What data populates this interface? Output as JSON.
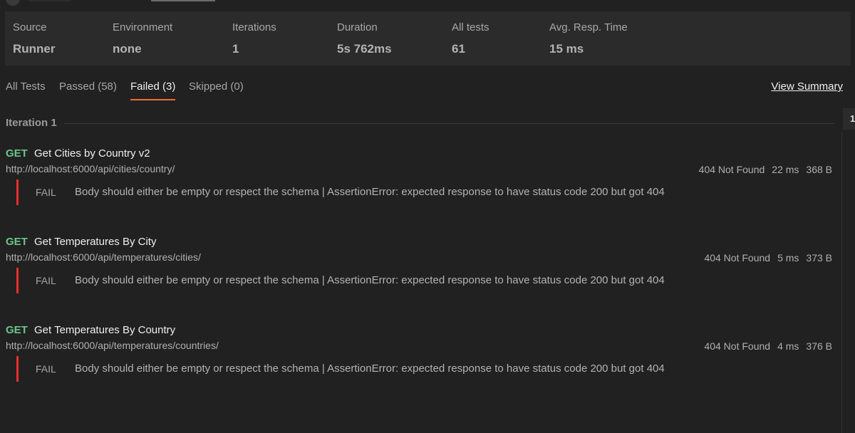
{
  "summary": {
    "source": {
      "label": "Source",
      "value": "Runner"
    },
    "environment": {
      "label": "Environment",
      "value": "none"
    },
    "iterations": {
      "label": "Iterations",
      "value": "1"
    },
    "duration": {
      "label": "Duration",
      "value": "5s 762ms"
    },
    "all_tests": {
      "label": "All tests",
      "value": "61"
    },
    "avg_resp": {
      "label": "Avg. Resp. Time",
      "value": "15 ms"
    }
  },
  "tabs": {
    "all": "All Tests",
    "passed": "Passed (58)",
    "failed": "Failed (3)",
    "skipped": "Skipped (0)",
    "active": "failed"
  },
  "view_summary": "View Summary",
  "iteration_label": "Iteration 1",
  "right_tab_label": "1",
  "requests": [
    {
      "method": "GET",
      "name": "Get Cities by Country v2",
      "url": "http://localhost:6000/api/cities/country/",
      "status": "404 Not Found",
      "time": "22 ms",
      "size": "368 B",
      "result": "FAIL",
      "message": "Body should either be empty or respect the schema | AssertionError: expected response to have status code 200 but got 404"
    },
    {
      "method": "GET",
      "name": "Get Temperatures By City",
      "url": "http://localhost:6000/api/temperatures/cities/",
      "status": "404 Not Found",
      "time": "5 ms",
      "size": "373 B",
      "result": "FAIL",
      "message": "Body should either be empty or respect the schema | AssertionError: expected response to have status code 200 but got 404"
    },
    {
      "method": "GET",
      "name": "Get Temperatures By Country",
      "url": "http://localhost:6000/api/temperatures/countries/",
      "status": "404 Not Found",
      "time": "4 ms",
      "size": "376 B",
      "result": "FAIL",
      "message": "Body should either be empty or respect the schema | AssertionError: expected response to have status code 200 but got 404"
    }
  ],
  "colors": {
    "background": "#212121",
    "panel": "#2b2b2b",
    "get_method": "#6cc58a",
    "fail_bar": "#e8302a",
    "active_tab_underline": "#f26b3a"
  }
}
